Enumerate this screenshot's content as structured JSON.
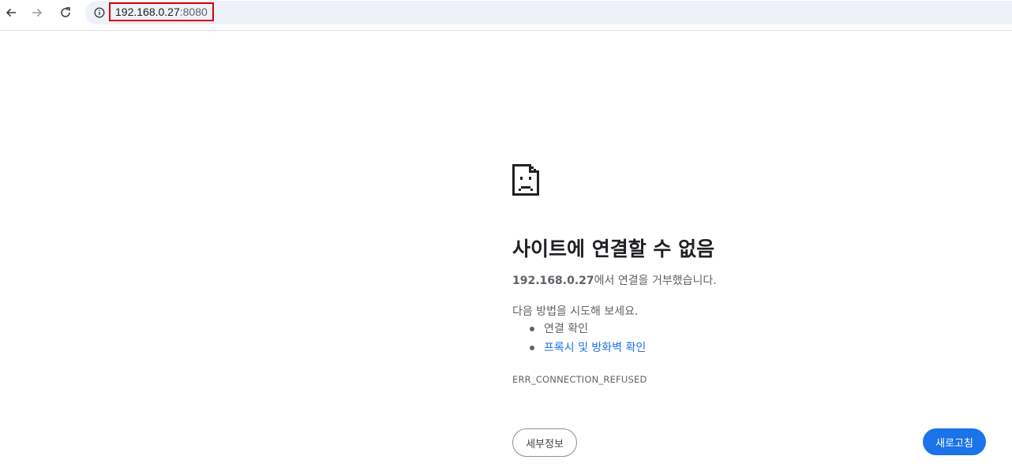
{
  "browser": {
    "url_host": "192.168.0.27",
    "url_port": ":8080",
    "icons": [
      "back-arrow-icon",
      "forward-arrow-icon",
      "reload-icon",
      "info-icon"
    ]
  },
  "error_page": {
    "icon": "sad-page-icon",
    "title": "사이트에 연결할 수 없음",
    "host": "192.168.0.27",
    "message_suffix": "에서 연결을 거부했습니다.",
    "suggestions_heading": "다음 방법을 시도해 보세요.",
    "suggestions": [
      {
        "label": "연결 확인",
        "is_link": false
      },
      {
        "label": "프록시 및 방화벽 확인",
        "is_link": true
      }
    ],
    "error_code": "ERR_CONNECTION_REFUSED",
    "details_button": "세부정보",
    "reload_button": "새로고침"
  },
  "colors": {
    "accent": "#1a73e8",
    "url_highlight_border": "#d90000",
    "omnibox_bg": "#eef1f8"
  }
}
